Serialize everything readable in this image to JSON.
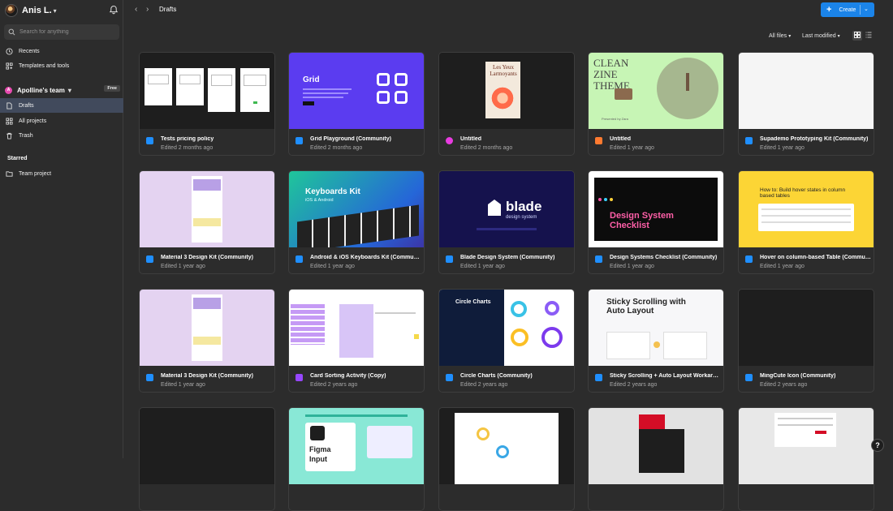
{
  "user": {
    "name": "Anis L."
  },
  "search": {
    "placeholder": "Search for anything"
  },
  "nav": {
    "recents": "Recents",
    "templates": "Templates and tools"
  },
  "team": {
    "name": "Apolline's team",
    "badge": "Free",
    "drafts": "Drafts",
    "all_projects": "All projects",
    "trash": "Trash"
  },
  "starred": {
    "label": "Starred",
    "item": "Team project"
  },
  "header": {
    "breadcrumb": "Drafts",
    "create_label": "Create"
  },
  "filters": {
    "all_files": "All files",
    "last_modified": "Last modified"
  },
  "colors": {
    "accent": "#1b84e9",
    "active_nav": "#414a5c",
    "figma_blue": "#1f8fff",
    "figjam_purple": "#9747ff",
    "slides_orange": "#ff7a30",
    "draw_pink": "#e83ce0"
  },
  "cards": [
    {
      "title": "Tests pricing policy",
      "subtitle": "Edited 2 months ago",
      "icon": "design-file-icon"
    },
    {
      "title": "Grid Playground (Community)",
      "subtitle": "Edited 2 months ago",
      "icon": "design-file-icon",
      "thumb_title": "Grid"
    },
    {
      "title": "Untitled",
      "subtitle": "Edited 2 months ago",
      "icon": "draw-file-icon",
      "thumb_title": "Les Yeux Larmoyants"
    },
    {
      "title": "Untitled",
      "subtitle": "Edited 1 year ago",
      "icon": "slides-file-icon",
      "thumb_title": "CLEAN ZINE THEME"
    },
    {
      "title": "Supademo Prototyping Kit (Community)",
      "subtitle": "Edited 1 year ago",
      "icon": "design-file-icon"
    },
    {
      "title": "Material 3 Design Kit (Community)",
      "subtitle": "Edited 1 year ago",
      "icon": "design-file-icon"
    },
    {
      "title": "Android & iOS Keyboards Kit (Community)",
      "subtitle": "Edited 1 year ago",
      "icon": "design-file-icon",
      "thumb_title": "Keyboards Kit",
      "thumb_sub": "iOS & Android"
    },
    {
      "title": "Blade Design System (Community)",
      "subtitle": "Edited 1 year ago",
      "icon": "design-file-icon",
      "thumb_title": "blade",
      "thumb_sub": "design system"
    },
    {
      "title": "Design Systems Checklist (Community)",
      "subtitle": "Edited 1 year ago",
      "icon": "design-file-icon",
      "thumb_title": "Design System Checklist"
    },
    {
      "title": "Hover on column-based Table (Communi…",
      "subtitle": "Edited 1 year ago",
      "icon": "design-file-icon",
      "thumb_title": "How to: Build hover states in column based tables"
    },
    {
      "title": "Material 3 Design Kit (Community)",
      "subtitle": "Edited 1 year ago",
      "icon": "design-file-icon"
    },
    {
      "title": "Card Sorting Activity (Copy)",
      "subtitle": "Edited 2 years ago",
      "icon": "figjam-file-icon"
    },
    {
      "title": "Circle Charts (Community)",
      "subtitle": "Edited 2 years ago",
      "icon": "design-file-icon",
      "thumb_title": "Circle Charts"
    },
    {
      "title": "Sticky Scrolling + Auto Layout Workarou…",
      "subtitle": "Edited 2 years ago",
      "icon": "design-file-icon",
      "thumb_title": "Sticky Scrolling with Auto Layout"
    },
    {
      "title": "MingCute Icon (Community)",
      "subtitle": "Edited 2 years ago",
      "icon": "design-file-icon"
    },
    {
      "title": "",
      "subtitle": "",
      "icon": ""
    },
    {
      "title": "",
      "subtitle": "",
      "icon": "",
      "thumb_title": "Figma Input"
    },
    {
      "title": "",
      "subtitle": "",
      "icon": ""
    },
    {
      "title": "",
      "subtitle": "",
      "icon": ""
    },
    {
      "title": "",
      "subtitle": "",
      "icon": ""
    }
  ]
}
